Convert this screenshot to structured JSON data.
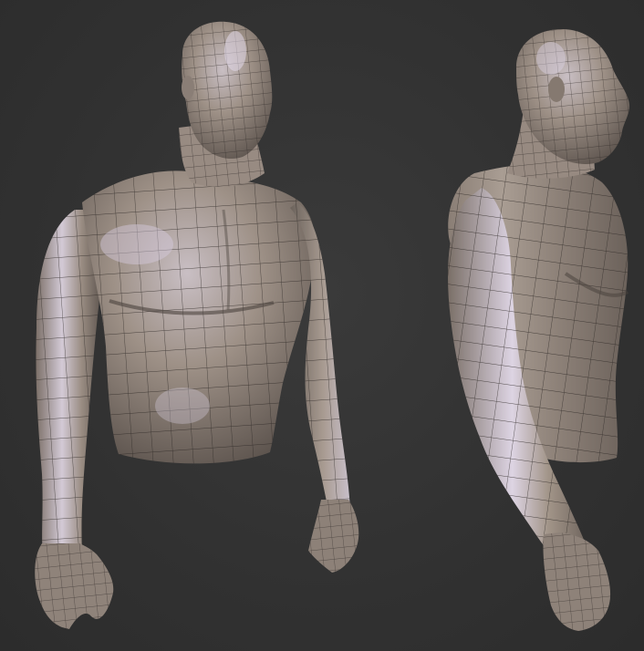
{
  "scene": {
    "background_color": "#333333",
    "model_base_color": "#9c8f85",
    "model_highlight_color": "#d8cfe0",
    "wireframe_color": "#2a2522",
    "views": [
      {
        "name": "front-three-quarter-view"
      },
      {
        "name": "side-view"
      }
    ]
  }
}
